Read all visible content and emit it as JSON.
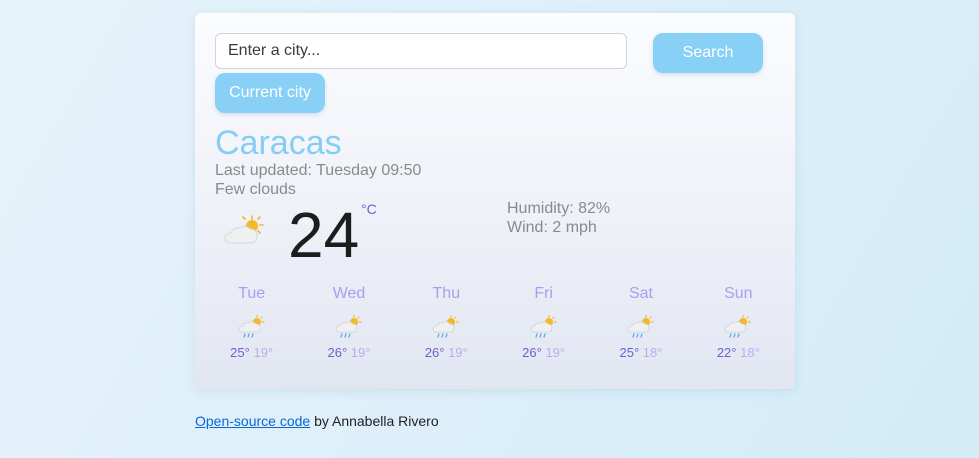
{
  "search": {
    "placeholder": "Enter a city...",
    "value": "",
    "search_button": "Search",
    "current_button": "Current city"
  },
  "current": {
    "city": "Caracas",
    "last_updated": "Last updated: Tuesday 09:50",
    "description": "Few clouds",
    "temperature": "24",
    "unit": "°C",
    "humidity": "Humidity: 82%",
    "wind": "Wind: 2 mph",
    "icon": "partly-cloudy-icon"
  },
  "forecast": [
    {
      "day": "Tue",
      "max": "25°",
      "min": "19°",
      "icon": "rain-sun-icon"
    },
    {
      "day": "Wed",
      "max": "26°",
      "min": "19°",
      "icon": "rain-sun-icon"
    },
    {
      "day": "Thu",
      "max": "26°",
      "min": "19°",
      "icon": "rain-sun-icon"
    },
    {
      "day": "Fri",
      "max": "26°",
      "min": "19°",
      "icon": "rain-sun-icon"
    },
    {
      "day": "Sat",
      "max": "25°",
      "min": "18°",
      "icon": "rain-sun-icon"
    },
    {
      "day": "Sun",
      "max": "22°",
      "min": "18°",
      "icon": "rain-sun-icon"
    }
  ],
  "footer": {
    "link_text": "Open-source code",
    "suffix": " by Annabella Rivero"
  },
  "colors": {
    "accent": "#89d0f7",
    "city": "#86cdf5",
    "forecast_day": "#a89ef0",
    "temp_max": "#6f5fce",
    "temp_min": "#b7aef2"
  }
}
